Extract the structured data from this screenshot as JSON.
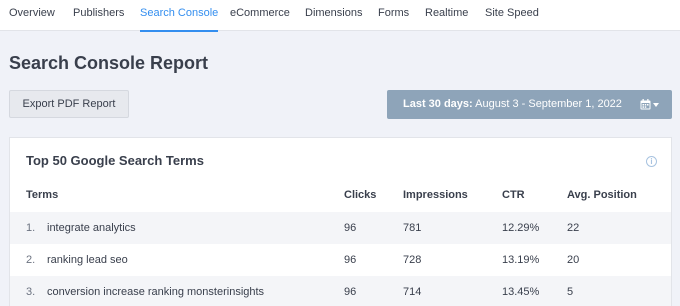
{
  "tabs": [
    {
      "label": "Overview",
      "active": false
    },
    {
      "label": "Publishers",
      "active": false
    },
    {
      "label": "Search Console",
      "active": true
    },
    {
      "label": "eCommerce",
      "active": false
    },
    {
      "label": "Dimensions",
      "active": false
    },
    {
      "label": "Forms",
      "active": false
    },
    {
      "label": "Realtime",
      "active": false
    },
    {
      "label": "Site Speed",
      "active": false
    }
  ],
  "page": {
    "title": "Search Console Report",
    "export_label": "Export PDF Report"
  },
  "date_range": {
    "prefix": "Last 30 days:",
    "range": "August 3 - September 1, 2022",
    "icon": "calendar-icon"
  },
  "colors": {
    "accent": "#338eef",
    "date_button": "#8ea4b9",
    "background": "#f0f2f8"
  },
  "card": {
    "title": "Top 50 Google Search Terms",
    "info_icon": "i",
    "columns": [
      "Terms",
      "Clicks",
      "Impressions",
      "CTR",
      "Avg. Position"
    ],
    "rows": [
      {
        "num": "1.",
        "term": "integrate analytics",
        "clicks": "96",
        "impressions": "781",
        "ctr": "12.29%",
        "position": "22"
      },
      {
        "num": "2.",
        "term": "ranking lead seo",
        "clicks": "96",
        "impressions": "728",
        "ctr": "13.19%",
        "position": "20"
      },
      {
        "num": "3.",
        "term": "conversion increase ranking monsterinsights",
        "clicks": "96",
        "impressions": "714",
        "ctr": "13.45%",
        "position": "5"
      }
    ]
  }
}
